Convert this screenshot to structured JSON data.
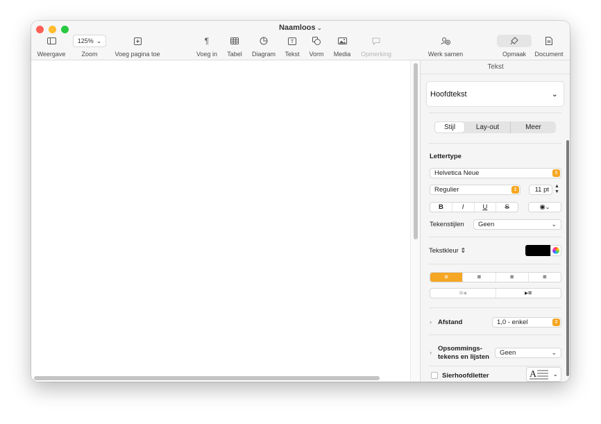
{
  "window": {
    "title": "Naamloos"
  },
  "toolbar": {
    "view": "Weergave",
    "zoom_value": "125%",
    "zoom": "Zoom",
    "add_page": "Voeg pagina toe",
    "insert": "Voeg in",
    "table": "Tabel",
    "chart": "Diagram",
    "text": "Tekst",
    "shape": "Vorm",
    "media": "Media",
    "comment": "Opmerking",
    "collaborate": "Werk samen",
    "format": "Opmaak",
    "document": "Document"
  },
  "panel": {
    "header": "Tekst",
    "paragraph_style": "Hoofdtekst",
    "tabs": [
      "Stijl",
      "Lay-out",
      "Meer"
    ],
    "font_section": "Lettertype",
    "font_family": "Helvetica Neue",
    "font_style": "Regulier",
    "font_size": "11 pt",
    "format_buttons": [
      "B",
      "I",
      "U",
      "S"
    ],
    "char_styles_label": "Tekenstijlen",
    "char_styles_value": "Geen",
    "text_color_label": "Tekstkleur",
    "text_color": "#000000",
    "spacing_label": "Afstand",
    "spacing_value": "1,0 - enkel",
    "bullets_label_1": "Opsommings-",
    "bullets_label_2": "tekens en lijsten",
    "bullets_value": "Geen",
    "dropcap_label": "Sierhoofdletter"
  },
  "colors": {
    "accent": "#f5a623"
  }
}
